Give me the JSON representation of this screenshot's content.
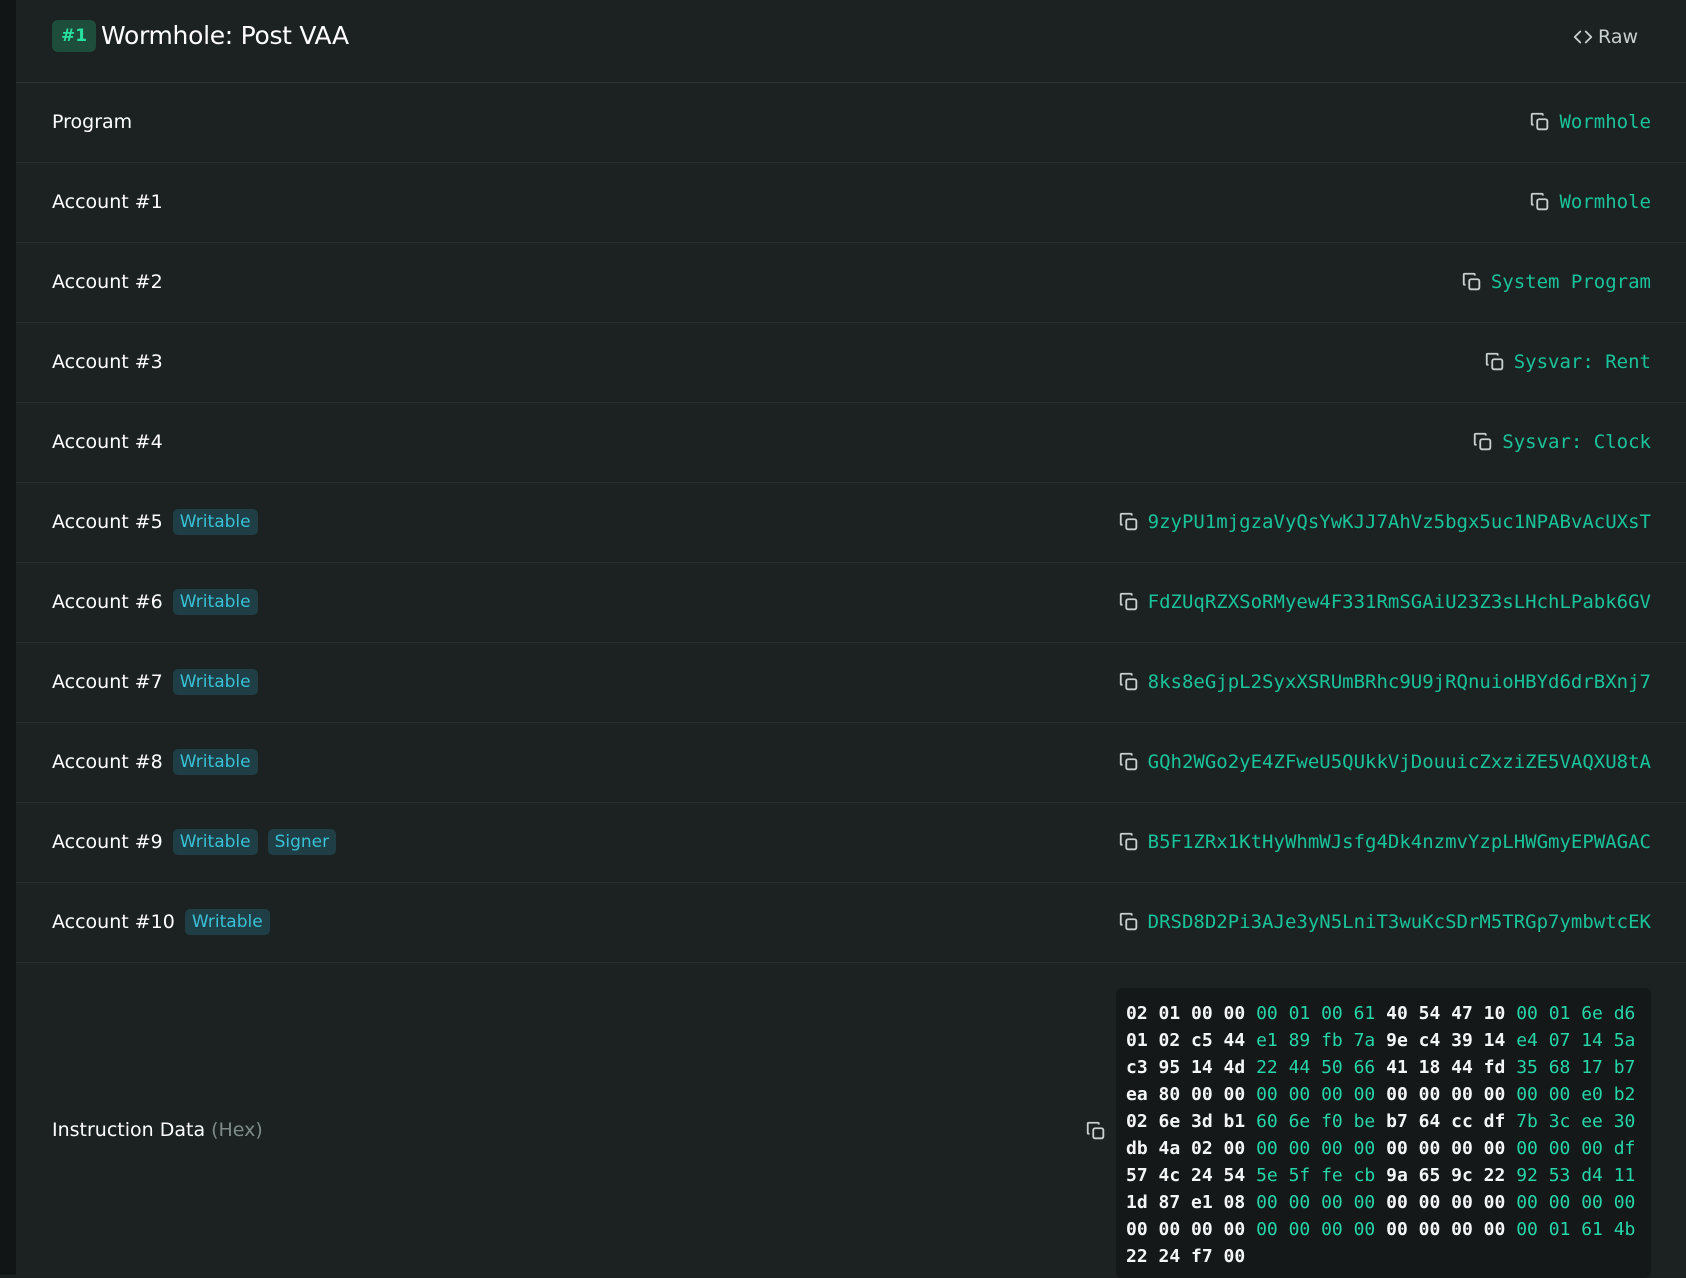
{
  "header": {
    "number_badge": "#1",
    "title": "Wormhole: Post VAA",
    "raw_label": "Raw"
  },
  "rows": [
    {
      "label": "Program",
      "badges": [],
      "value": "Wormhole"
    },
    {
      "label": "Account #1",
      "badges": [],
      "value": "Wormhole"
    },
    {
      "label": "Account #2",
      "badges": [],
      "value": "System Program"
    },
    {
      "label": "Account #3",
      "badges": [],
      "value": "Sysvar: Rent"
    },
    {
      "label": "Account #4",
      "badges": [],
      "value": "Sysvar: Clock"
    },
    {
      "label": "Account #5",
      "badges": [
        "Writable"
      ],
      "value": "9zyPU1mjgzaVyQsYwKJJ7AhVz5bgx5uc1NPABvAcUXsT"
    },
    {
      "label": "Account #6",
      "badges": [
        "Writable"
      ],
      "value": "FdZUqRZXSoRMyew4F331RmSGAiU23Z3sLHchLPabk6GV"
    },
    {
      "label": "Account #7",
      "badges": [
        "Writable"
      ],
      "value": "8ks8eGjpL2SyxXSRUmBRhc9U9jRQnuioHBYd6drBXnj7"
    },
    {
      "label": "Account #8",
      "badges": [
        "Writable"
      ],
      "value": "GQh2WGo2yE4ZFweU5QUkkVjDouuicZxziZE5VAQXU8tA"
    },
    {
      "label": "Account #9",
      "badges": [
        "Writable",
        "Signer"
      ],
      "value": "B5F1ZRx1KtHyWhmWJsfg4Dk4nzmvYzpLHWGmyEPWAGAC"
    },
    {
      "label": "Account #10",
      "badges": [
        "Writable"
      ],
      "value": "DRSD8D2Pi3AJe3yN5LniT3wuKcSDrM5TRGp7ymbwtcEK"
    }
  ],
  "instruction_data": {
    "label": "Instruction Data",
    "suffix": "(Hex)",
    "lines": [
      [
        "02 01 00 00",
        "00 01 00 61",
        "40 54 47 10",
        "00 01 6e d6"
      ],
      [
        "01 02 c5 44",
        "e1 89 fb 7a",
        "9e c4 39 14",
        "e4 07 14 5a"
      ],
      [
        "c3 95 14 4d",
        "22 44 50 66",
        "41 18 44 fd",
        "35 68 17 b7"
      ],
      [
        "ea 80 00 00",
        "00 00 00 00",
        "00 00 00 00",
        "00 00 e0 b2"
      ],
      [
        "02 6e 3d b1",
        "60 6e f0 be",
        "b7 64 cc df",
        "7b 3c ee 30"
      ],
      [
        "db 4a 02 00",
        "00 00 00 00",
        "00 00 00 00",
        "00 00 00 df"
      ],
      [
        "57 4c 24 54",
        "5e 5f fe cb",
        "9a 65 9c 22",
        "92 53 d4 11"
      ],
      [
        "1d 87 e1 08",
        "00 00 00 00",
        "00 00 00 00",
        "00 00 00 00"
      ],
      [
        "00 00 00 00",
        "00 00 00 00",
        "00 00 00 00",
        "00 01 61 4b"
      ],
      [
        "22 24 f7 00"
      ]
    ]
  },
  "icons": {
    "copy": "copy-icon",
    "code": "code-icon"
  },
  "colors": {
    "accent": "#19c39a",
    "badge_text": "#39c1d6",
    "badge_bg": "#1f3e45",
    "background": "#1c2222"
  }
}
